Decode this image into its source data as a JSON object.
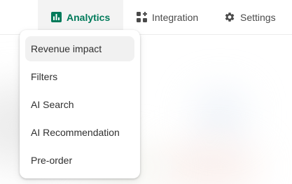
{
  "nav": {
    "tabs": [
      {
        "label": "Analytics",
        "icon": "bar-chart-icon",
        "active": true,
        "color": "#007a5a"
      },
      {
        "label": "Integration",
        "icon": "apps-icon",
        "active": false
      },
      {
        "label": "Settings",
        "icon": "gear-icon",
        "active": false
      }
    ]
  },
  "dropdown": {
    "items": [
      {
        "label": "Revenue impact",
        "active": true
      },
      {
        "label": "Filters"
      },
      {
        "label": "AI Search"
      },
      {
        "label": "AI Recommendation"
      },
      {
        "label": "Pre-order"
      }
    ]
  }
}
